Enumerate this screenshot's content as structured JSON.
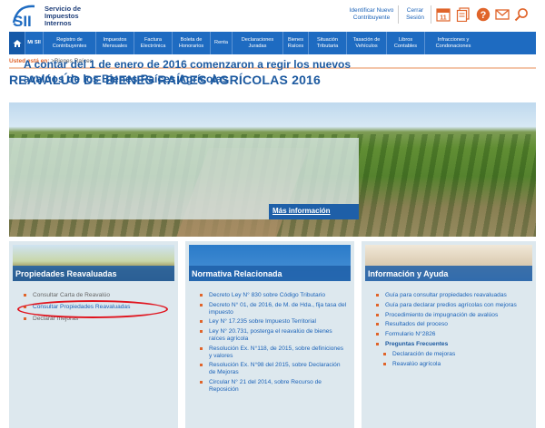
{
  "header": {
    "logo_text_line1": "Servicio de",
    "logo_text_line2": "Impuestos",
    "logo_text_line3": "Internos",
    "links": [
      {
        "label_line1": "Identificar Nuevo",
        "label_line2": "Contribuyente"
      },
      {
        "label_line1": "Cerrar",
        "label_line2": "Sesión"
      }
    ],
    "calendar_day": "11",
    "icons": [
      "calendar-icon",
      "documents-icon",
      "help-icon",
      "mail-icon",
      "search-icon"
    ]
  },
  "nav": {
    "items": [
      {
        "label": "Mi SII"
      },
      {
        "label": "Registro de Contribuyentes"
      },
      {
        "label": "Impuestos Mensuales"
      },
      {
        "label": "Factura Electrónica"
      },
      {
        "label": "Boleta de Honorarios"
      },
      {
        "label": "Renta"
      },
      {
        "label": "Declaraciones Juradas"
      },
      {
        "label": "Bienes Raíces"
      },
      {
        "label": "Situación Tributaria"
      },
      {
        "label": "Tasación de Vehículos"
      },
      {
        "label": "Libros Contables"
      },
      {
        "label": "Infracciones y Condonaciones"
      }
    ]
  },
  "breadcrumb": {
    "label": "Usted está en:",
    "path": ">Bienes Raíces"
  },
  "page_title": "REAVALÚO DE BIENES RAÍCES AGRÍCOLAS 2016",
  "banner": {
    "text": "A contar del 1 de enero de 2016 comenzaron a regir los nuevos avalúos de los Bienes Raíces Agrícolas",
    "more_label": "Más información"
  },
  "columns": [
    {
      "title": "Propiedades Reavaluadas",
      "items": [
        {
          "label": "Consultar Carta de Reavalúo"
        },
        {
          "label": "Consultar Propiedades Reavaluadas"
        },
        {
          "label": "Declarar mejoras"
        }
      ]
    },
    {
      "title": "Normativa Relacionada",
      "items": [
        {
          "label": "Decreto Ley N° 830 sobre Código Tributario"
        },
        {
          "label": "Decreto N° 01, de 2016, de M. de Hda., fija tasa del impuesto"
        },
        {
          "label": "Ley N° 17.235 sobre Impuesto Territorial"
        },
        {
          "label": "Ley N° 20.731, posterga el reavalúo de bienes raíces agrícola"
        },
        {
          "label": "Resolución Ex. N°118, de 2015, sobre definiciones y valores"
        },
        {
          "label": "Resolución Ex. N°98 del 2015, sobre Declaración de Mejoras"
        },
        {
          "label": "Circular N° 21 del 2014, sobre Recurso de Reposición"
        }
      ]
    },
    {
      "title": "Información y Ayuda",
      "items": [
        {
          "label": "Guía para consultar propiedades reavaluadas"
        },
        {
          "label": "Guía para declarar predios agrícolas con mejoras"
        },
        {
          "label": "Procedimiento de impugnación de avalúos"
        },
        {
          "label": "Resultados del proceso"
        },
        {
          "label": "Formulario N°2826"
        },
        {
          "label": "Preguntas Frecuentes"
        },
        {
          "label": "Declaración de mejoras"
        },
        {
          "label": "Reavalúo agrícola"
        }
      ]
    }
  ],
  "colors": {
    "brand_blue": "#1e6bc1",
    "title_blue": "#1d5aa0",
    "link_blue": "#1a62b8",
    "accent_orange": "#e0642a",
    "highlight_red": "#e0131d"
  }
}
